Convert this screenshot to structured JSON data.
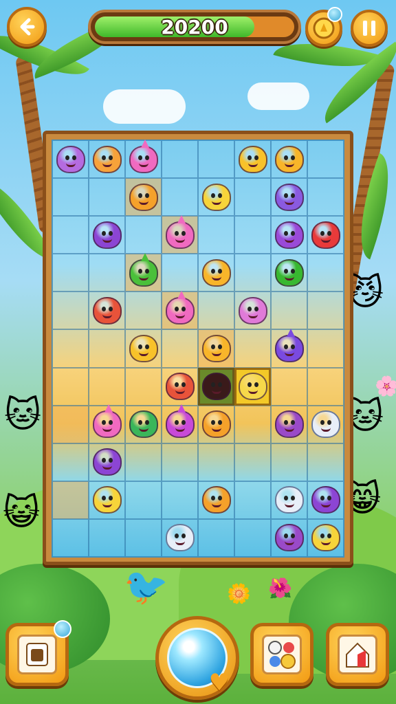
{
  "hud": {
    "back_icon": "back-arrow-icon",
    "score": "20200",
    "score_progress": 0.8,
    "coin_icon": "gold-coin-icon",
    "pause_icon": "pause-icon"
  },
  "board": {
    "columns": 8,
    "rows": 11,
    "cells": [
      [
        "violet-blob",
        "orange-catgirl",
        "pink-spike",
        "",
        "",
        "yellow-sun",
        "orange-sun",
        ""
      ],
      [
        "",
        "",
        "orange-cat",
        "",
        "yellow-chick",
        "",
        "purple-whale",
        ""
      ],
      [
        "",
        "purple-cat",
        "",
        "pink-spike",
        "",
        "",
        "purple-lips",
        "red-cat"
      ],
      [
        "",
        "",
        "green-spike",
        "",
        "orange-sun",
        "",
        "green-bird",
        ""
      ],
      [
        "",
        "red-fox",
        "",
        "pink-spike",
        "",
        "pink-cat",
        "",
        ""
      ],
      [
        "",
        "",
        "yellow-sun",
        "",
        "orange-sun",
        "",
        "purple-spike",
        ""
      ],
      [
        "",
        "",
        "",
        "red-fox",
        "black-cat",
        "yellow-smile",
        "",
        ""
      ],
      [
        "",
        "pink-spike",
        "green-cat",
        "magenta-spike",
        "orange-cat",
        "",
        "purple-blob",
        "white-cat"
      ],
      [
        "",
        "purple-cat",
        "",
        "",
        "",
        "",
        "",
        ""
      ],
      [
        "",
        "yellow-chick",
        "",
        "",
        "orange-cat",
        "",
        "white-cat",
        "purple-cat"
      ],
      [
        "",
        "",
        "",
        "white-cat",
        "",
        "",
        "purple-blob",
        "yellow-chick"
      ]
    ],
    "highlight_cells": [
      [
        1,
        2
      ],
      [
        2,
        3
      ],
      [
        3,
        2
      ],
      [
        4,
        3
      ],
      [
        5,
        4
      ],
      [
        7,
        0
      ],
      [
        9,
        0
      ]
    ],
    "selected_cell": [
      6,
      5
    ],
    "dark_cell": [
      6,
      4
    ]
  },
  "controls": {
    "left_icon": "card-icon",
    "center_icon": "magic-orb-icon",
    "heart_icon": "heart-icon",
    "right_a_icon": "character-pack-icon",
    "right_b_icon": "house-icon"
  },
  "colors": {
    "violet-blob": "#b56be0",
    "orange-catgirl": "#f7a23a",
    "pink-spike": "#f06ac0",
    "yellow-sun": "#f8c22a",
    "orange-sun": "#f8b52a",
    "orange-cat": "#f5a12a",
    "yellow-chick": "#f7d43a",
    "purple-whale": "#8a5ae0",
    "purple-cat": "#8c45d4",
    "purple-lips": "#9a4ad8",
    "red-cat": "#e83a3a",
    "green-spike": "#4ac03a",
    "green-bird": "#38b830",
    "red-fox": "#e8533a",
    "pink-cat": "#e07ad8",
    "purple-spike": "#7a4ae0",
    "black-cat": "#3a1a1a",
    "yellow-smile": "#f6d84a",
    "green-cat": "#3ab65a",
    "magenta-spike": "#c84ad8",
    "purple-blob": "#9a4ac8",
    "white-cat": "#e8eef8"
  }
}
